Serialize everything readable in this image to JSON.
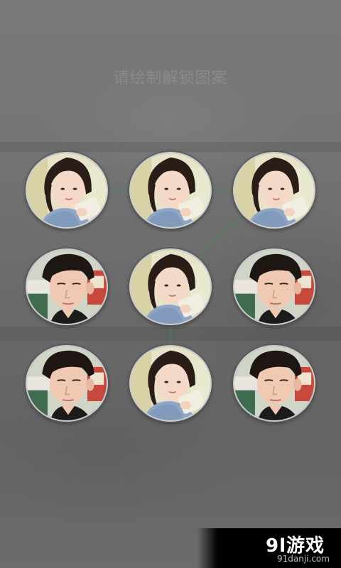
{
  "lock_screen": {
    "prompt": "请绘制解锁图案",
    "grid": {
      "rows": 3,
      "cols": 3,
      "dots": [
        {
          "photo": "girl-reading-photo"
        },
        {
          "photo": "girl-reading-photo"
        },
        {
          "photo": "girl-reading-photo"
        },
        {
          "photo": "boy-portrait-photo"
        },
        {
          "photo": "girl-reading-photo"
        },
        {
          "photo": "boy-portrait-photo"
        },
        {
          "photo": "boy-portrait-photo"
        },
        {
          "photo": "girl-reading-photo"
        },
        {
          "photo": "boy-portrait-photo"
        }
      ]
    }
  },
  "watermark": {
    "logo_text": "9l游戏",
    "url": "91danji.com"
  },
  "colors": {
    "background": "#6e6e6e",
    "prompt_text": "#8a8a8a",
    "trail_line": "#4f8a5a",
    "dot_ring": "#e1e1e1"
  }
}
